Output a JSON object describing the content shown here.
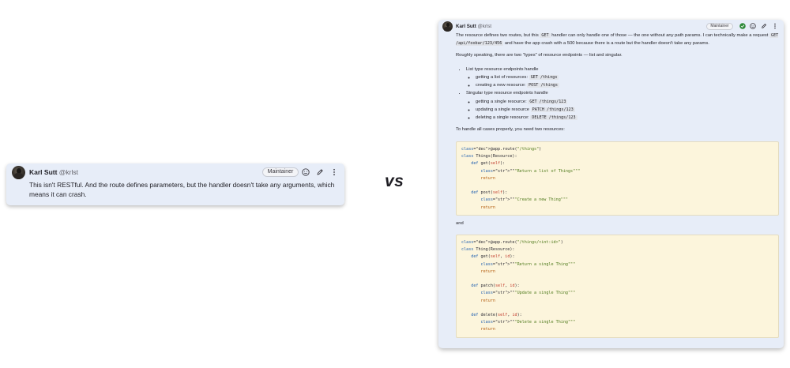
{
  "left_comment": {
    "author_name": "Karl Sutt",
    "author_handle": "@krlst",
    "badge": "Maintainer",
    "text": "This isn't RESTful. And the route defines parameters, but the handler doesn't take any arguments, which means it can crash.",
    "icons": [
      "emoji-icon",
      "edit-icon",
      "more-options-icon"
    ]
  },
  "separator_text": "vs",
  "right_comment": {
    "author_name": "Karl Sutt",
    "author_handle": "@krlst",
    "badge": "Maintainer",
    "icons": [
      "resolve-check-icon",
      "emoji-icon",
      "edit-icon",
      "more-options-icon"
    ],
    "para1": {
      "t1": "The resource defines two routes, but this",
      "c1": "GET",
      "t2": "handler can only handle one of those — the one without any path params. I can technically make a request",
      "c2": "GET /api/foobar/123/456",
      "t3": "and have the app crash with a 500 because there is a route but the handler doesn't take any params."
    },
    "para2": "Roughly speaking, there are two \"types\" of resource endpoints — list and singular.",
    "list": {
      "item1": "List type resource endpoints handle",
      "item1_sub": [
        {
          "text": "getting a list of resources:",
          "code": "GET /things"
        },
        {
          "text": "creating a new resource:",
          "code": "POST /things"
        }
      ],
      "item2": "Singular type resource endpoints handle",
      "item2_sub": [
        {
          "text": "getting a single resource:",
          "code": "GET /things/123"
        },
        {
          "text": "updating a single resource",
          "code": "PATCH /things/123"
        },
        {
          "text": "deleting a single resource:",
          "code": "DELETE /things/123"
        }
      ]
    },
    "para3": "To handle all cases properly, you need two resources:",
    "code1": [
      "@app.route(\"/things\")",
      "class Things(Resource):",
      "    def get(self):",
      "        \"\"\"Return a list of Things\"\"\"",
      "        return",
      "",
      "    def post(self):",
      "        \"\"\"Create a new Thing\"\"\"",
      "        return"
    ],
    "and_text": "and",
    "code2": [
      "@app.route(\"/things/<int:id>\")",
      "class Thing(Resource):",
      "    def get(self, id):",
      "        \"\"\"Return a single Thing\"\"\"",
      "        return",
      "",
      "    def patch(self, id):",
      "        \"\"\"Update a single Thing\"\"\"",
      "        return",
      "",
      "    def delete(self, id):",
      "        \"\"\"Delete a single Thing\"\"\"",
      "        return"
    ]
  },
  "colors": {
    "card_bg": "#e7edf8",
    "code_bg": "#fcf5dc",
    "check_green": "#2f8a3a"
  }
}
